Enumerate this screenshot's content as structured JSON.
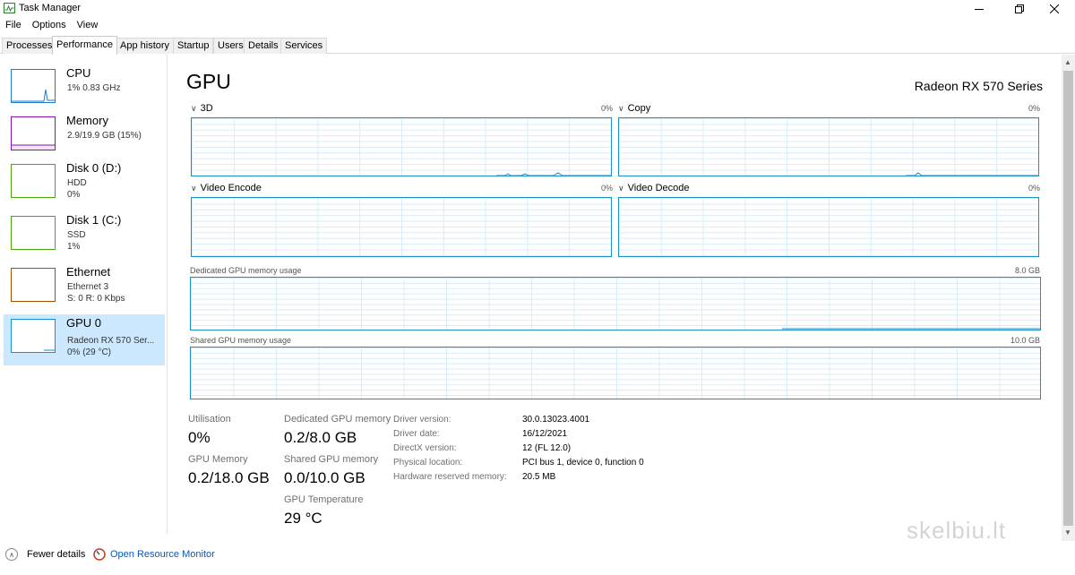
{
  "window": {
    "title": "Task Manager"
  },
  "menu": [
    "File",
    "Options",
    "View"
  ],
  "tabs": [
    "Processes",
    "Performance",
    "App history",
    "Startup",
    "Users",
    "Details",
    "Services"
  ],
  "sidebar": {
    "items": [
      {
        "title": "CPU",
        "lines": [
          "1% 0.83 GHz"
        ],
        "color": "#1e7bc4"
      },
      {
        "title": "Memory",
        "lines": [
          "2.9/19.9 GB (15%)"
        ],
        "color": "#8b12ae"
      },
      {
        "title": "Disk 0 (D:)",
        "lines": [
          "HDD",
          "0%"
        ],
        "color": "#4da60c"
      },
      {
        "title": "Disk 1 (C:)",
        "lines": [
          "SSD",
          "1%"
        ],
        "color": "#4da60c"
      },
      {
        "title": "Ethernet",
        "lines": [
          "Ethernet 3",
          "S: 0 R: 0 Kbps"
        ],
        "color": "#a74f01"
      },
      {
        "title": "GPU 0",
        "lines": [
          "Radeon RX 570 Ser...",
          "0% (29 °C)"
        ],
        "color": "#1b8fc8"
      }
    ]
  },
  "main": {
    "heading": "GPU",
    "gpu_name": "Radeon RX 570 Series",
    "engines": [
      {
        "label": "3D",
        "pct": "0%"
      },
      {
        "label": "Copy",
        "pct": "0%"
      },
      {
        "label": "Video Encode",
        "pct": "0%"
      },
      {
        "label": "Video Decode",
        "pct": "0%"
      }
    ],
    "dedicated_label": "Dedicated GPU memory usage",
    "dedicated_max": "8.0 GB",
    "shared_label": "Shared GPU memory usage",
    "shared_max": "10.0 GB"
  },
  "stats": {
    "utilisation_label": "Utilisation",
    "utilisation_value": "0%",
    "gpu_memory_label": "GPU Memory",
    "gpu_memory_value": "0.2/18.0 GB",
    "dedicated_label": "Dedicated GPU memory",
    "dedicated_value": "0.2/8.0 GB",
    "shared_label": "Shared GPU memory",
    "shared_value": "0.0/10.0 GB",
    "temp_label": "GPU Temperature",
    "temp_value": "29 °C"
  },
  "info": [
    {
      "label": "Driver version:",
      "value": "30.0.13023.4001"
    },
    {
      "label": "Driver date:",
      "value": "16/12/2021"
    },
    {
      "label": "DirectX version:",
      "value": "12 (FL 12.0)"
    },
    {
      "label": "Physical location:",
      "value": "PCI bus 1, device 0, function 0"
    },
    {
      "label": "Hardware reserved memory:",
      "value": "20.5 MB"
    }
  ],
  "footer": {
    "fewer_details": "Fewer details",
    "resource_monitor": "Open Resource Monitor"
  },
  "watermark": "skelbiu.lt"
}
